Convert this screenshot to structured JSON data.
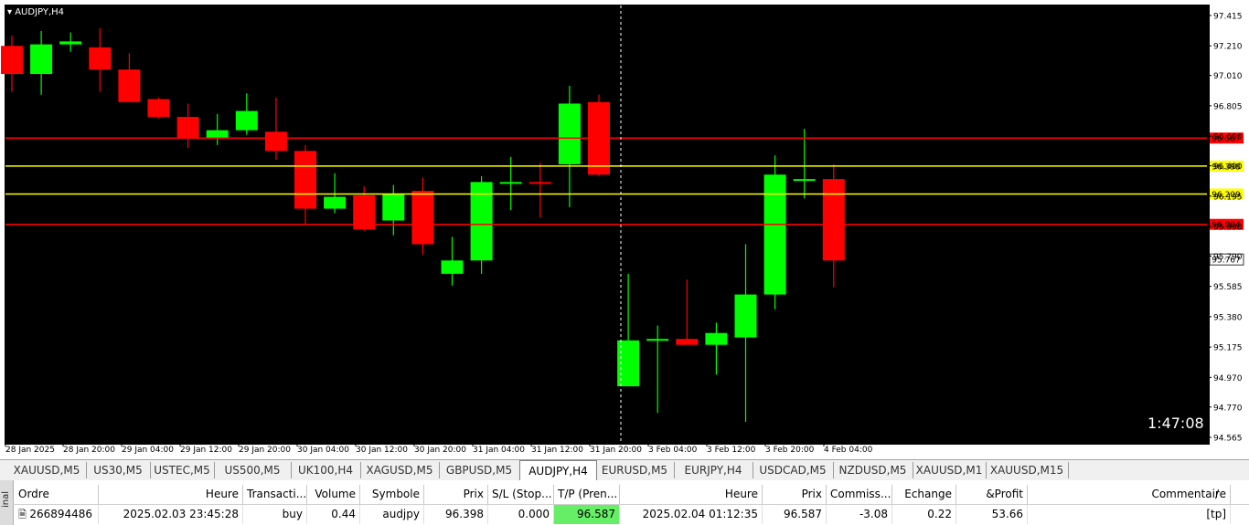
{
  "chart": {
    "symbol_label": "AUDJPY,H4",
    "countdown": "1:47:08",
    "colors": {
      "bull": "#00ff00",
      "bear": "#ff0000",
      "background": "#000000",
      "red_level": "#ff0000",
      "yellow_level": "#ffff00",
      "crosshair": "#ffffff"
    }
  },
  "chart_data": {
    "type": "candlestick",
    "ylim": [
      94.565,
      97.415
    ],
    "y_ticks": [
      "97.415",
      "97.210",
      "97.010",
      "96.805",
      "96.600",
      "96.400",
      "96.195",
      "95.990",
      "95.790",
      "95.585",
      "95.380",
      "95.175",
      "94.970",
      "94.770",
      "94.565"
    ],
    "x_ticks": [
      "28 Jan 2025",
      "28 Jan 20:00",
      "29 Jan 04:00",
      "29 Jan 12:00",
      "29 Jan 20:00",
      "30 Jan 04:00",
      "30 Jan 12:00",
      "30 Jan 20:00",
      "31 Jan 04:00",
      "31 Jan 12:00",
      "31 Jan 20:00",
      "3 Feb 04:00",
      "3 Feb 12:00",
      "3 Feb 20:00",
      "4 Feb 04:00"
    ],
    "candles": [
      {
        "o": 97.21,
        "h": 97.28,
        "l": 96.9,
        "c": 97.02
      },
      {
        "o": 97.02,
        "h": 97.31,
        "l": 96.88,
        "c": 97.22
      },
      {
        "o": 97.22,
        "h": 97.3,
        "l": 97.17,
        "c": 97.24
      },
      {
        "o": 97.2,
        "h": 97.33,
        "l": 96.9,
        "c": 97.05
      },
      {
        "o": 97.05,
        "h": 97.16,
        "l": 96.83,
        "c": 96.83
      },
      {
        "o": 96.85,
        "h": 96.86,
        "l": 96.72,
        "c": 96.73
      },
      {
        "o": 96.73,
        "h": 96.82,
        "l": 96.52,
        "c": 96.59
      },
      {
        "o": 96.59,
        "h": 96.75,
        "l": 96.54,
        "c": 96.64
      },
      {
        "o": 96.64,
        "h": 96.89,
        "l": 96.61,
        "c": 96.77
      },
      {
        "o": 96.63,
        "h": 96.86,
        "l": 96.44,
        "c": 96.5
      },
      {
        "o": 96.5,
        "h": 96.54,
        "l": 96.0,
        "c": 96.11
      },
      {
        "o": 96.11,
        "h": 96.35,
        "l": 96.08,
        "c": 96.19
      },
      {
        "o": 96.2,
        "h": 96.26,
        "l": 95.96,
        "c": 95.97
      },
      {
        "o": 96.03,
        "h": 96.27,
        "l": 95.93,
        "c": 96.21
      },
      {
        "o": 96.23,
        "h": 96.32,
        "l": 95.8,
        "c": 95.87
      },
      {
        "o": 95.67,
        "h": 95.92,
        "l": 95.59,
        "c": 95.76
      },
      {
        "o": 95.76,
        "h": 96.33,
        "l": 95.67,
        "c": 96.29
      },
      {
        "o": 96.28,
        "h": 96.46,
        "l": 96.1,
        "c": 96.29
      },
      {
        "o": 96.29,
        "h": 96.42,
        "l": 96.05,
        "c": 96.28
      },
      {
        "o": 96.41,
        "h": 96.94,
        "l": 96.12,
        "c": 96.82
      },
      {
        "o": 96.83,
        "h": 96.88,
        "l": 96.33,
        "c": 96.34
      },
      {
        "o": 94.91,
        "h": 95.67,
        "l": 94.91,
        "c": 95.22
      },
      {
        "o": 95.23,
        "h": 95.32,
        "l": 94.73,
        "c": 95.23
      },
      {
        "o": 95.23,
        "h": 95.63,
        "l": 95.19,
        "c": 95.19
      },
      {
        "o": 95.19,
        "h": 95.34,
        "l": 94.99,
        "c": 95.27
      },
      {
        "o": 95.24,
        "h": 95.87,
        "l": 94.67,
        "c": 95.53
      },
      {
        "o": 95.53,
        "h": 96.47,
        "l": 95.43,
        "c": 96.34
      },
      {
        "o": 96.31,
        "h": 96.65,
        "l": 96.18,
        "c": 96.31
      },
      {
        "o": 96.31,
        "h": 96.41,
        "l": 95.58,
        "c": 95.76
      }
    ],
    "levels": [
      {
        "value": 96.587,
        "label": "96.587",
        "color": "red"
      },
      {
        "value": 96.398,
        "label": "96.398",
        "color": "yellow"
      },
      {
        "value": 96.209,
        "label": "96.209",
        "color": "yellow"
      },
      {
        "value": 96.004,
        "label": "96.004",
        "color": "red"
      }
    ],
    "current_price": "95.767"
  },
  "tabs": [
    "XAUUSD,M5",
    "US30,M5",
    "USTEC,M5",
    "US500,M5",
    "UK100,H4",
    "XAGUSD,M5",
    "GBPUSD,M5",
    "AUDJPY,H4",
    "EURUSD,M5",
    "EURJPY,H4",
    "USDCAD,M5",
    "NZDUSD,M5",
    "XAUUSD,M1",
    "XAUUSD,M15"
  ],
  "active_tab": "AUDJPY,H4",
  "terminal": {
    "side_label": "inal",
    "headers": [
      "Ordre",
      "Heure",
      "Transacti...",
      "Volume",
      "Symbole",
      "Prix",
      "S/L (Stop...",
      "T/P (Pren...",
      "Heure",
      "Prix",
      "Commiss...",
      "Echange",
      "&Profit",
      "Commentaire"
    ],
    "sort_arrow": "/",
    "row": [
      "266894486",
      "2025.02.03 23:45:28",
      "buy",
      "0.44",
      "audjpy",
      "96.398",
      "0.000",
      "96.587",
      "2025.02.04 01:12:35",
      "96.587",
      "-3.08",
      "0.22",
      "53.66",
      "[tp]"
    ],
    "tp_highlight": "#66ee66"
  }
}
